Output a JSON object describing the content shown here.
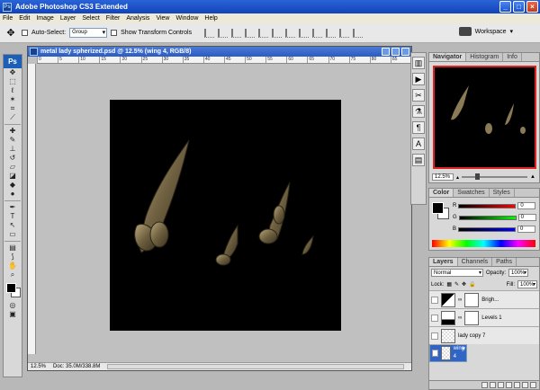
{
  "app": {
    "title": "Adobe Photoshop CS3 Extended"
  },
  "window_buttons": [
    "_",
    "□",
    "×"
  ],
  "menu": [
    "File",
    "Edit",
    "Image",
    "Layer",
    "Select",
    "Filter",
    "Analysis",
    "View",
    "Window",
    "Help"
  ],
  "options": {
    "auto_select_label": "Auto-Select:",
    "auto_select_value": "Group",
    "transform_label": "Show Transform Controls",
    "workspace_label": "Workspace"
  },
  "document": {
    "title": "metal lady spherized.psd @ 12.5% (wing 4, RGB/8)",
    "zoom": "12.5%",
    "doc_info": "Doc: 35.0M/338.8M",
    "ruler_ticks": [
      "0",
      "5",
      "10",
      "15",
      "20",
      "25",
      "30",
      "35",
      "40",
      "45",
      "50",
      "55",
      "60",
      "65",
      "70",
      "75",
      "80",
      "85"
    ]
  },
  "navigator": {
    "tabs": [
      "Navigator",
      "Histogram",
      "Info"
    ],
    "zoom": "12.5%"
  },
  "color_panel": {
    "tabs": [
      "Color",
      "Swatches",
      "Styles"
    ],
    "r": "0",
    "g": "0",
    "b": "0",
    "r_label": "R",
    "g_label": "G",
    "b_label": "B"
  },
  "layers_panel": {
    "tabs": [
      "Layers",
      "Channels",
      "Paths"
    ],
    "blend_mode": "Normal",
    "opacity_label": "Opacity:",
    "opacity": "100%",
    "lock_label": "Lock:",
    "fill_label": "Fill:",
    "fill": "100%",
    "layers": [
      {
        "name": "Brigh...",
        "kind": "adjustment"
      },
      {
        "name": "Levels 1",
        "kind": "levels"
      },
      {
        "name": "lady copy 7",
        "kind": "pixel"
      },
      {
        "name": "wing 4",
        "kind": "pixel-selected"
      }
    ]
  },
  "colors": {
    "title_blue": "#2a63d8",
    "selected_layer": "#3165c5",
    "nav_box": "#d22222"
  }
}
